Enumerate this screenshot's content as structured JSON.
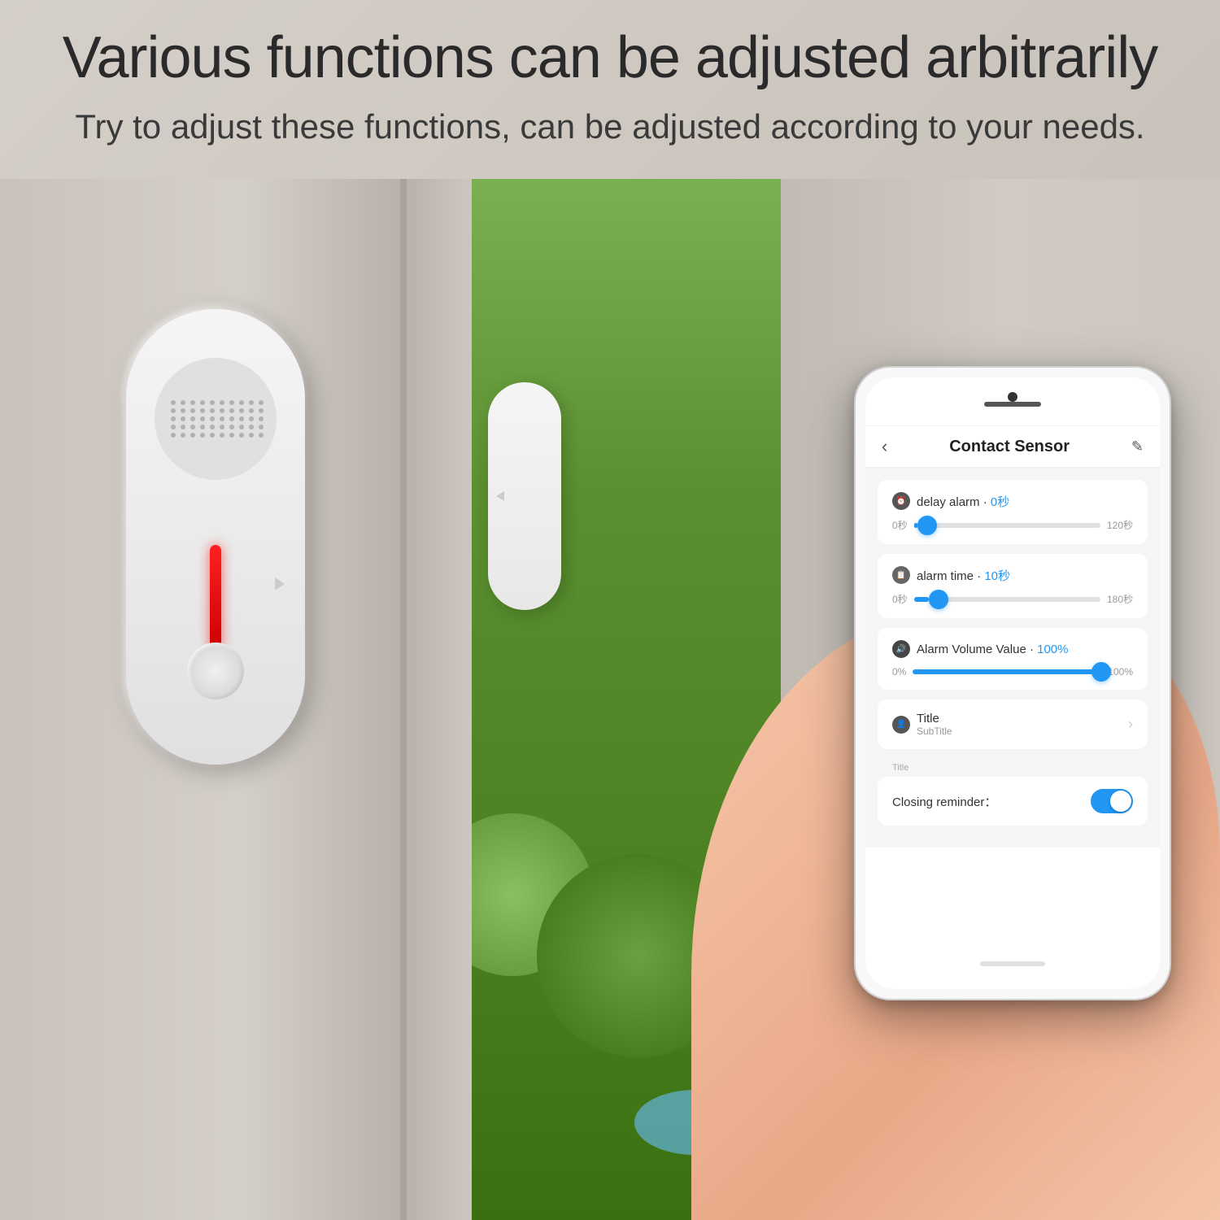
{
  "page": {
    "background_color": "#d5cfc9"
  },
  "header": {
    "main_title": "Various functions can be adjusted arbitrarily",
    "sub_title": "Try to adjust these functions, can be adjusted according to your needs."
  },
  "phone": {
    "app_title": "Contact Sensor",
    "back_label": "‹",
    "edit_label": "✎",
    "settings": [
      {
        "id": "delay_alarm",
        "icon": "⏰",
        "label": "delay alarm",
        "separator": "·",
        "value": "0秒",
        "slider_min": "0秒",
        "slider_max": "120秒",
        "slider_percent": 2
      },
      {
        "id": "alarm_time",
        "icon": "📋",
        "label": "alarm time",
        "separator": "·",
        "value": "10秒",
        "slider_min": "0秒",
        "slider_max": "180秒",
        "slider_percent": 8
      },
      {
        "id": "alarm_volume",
        "icon": "🔊",
        "label": "Alarm Volume Value",
        "separator": "·",
        "value": "100%",
        "slider_min": "0%",
        "slider_max": "100%",
        "slider_percent": 100
      }
    ],
    "nav_item": {
      "icon": "👤",
      "title": "Title",
      "subtitle": "SubTitle"
    },
    "title_section_label": "Title",
    "closing_reminder": {
      "label": "Closing reminder：",
      "enabled": true
    },
    "home_button_label": "□"
  }
}
